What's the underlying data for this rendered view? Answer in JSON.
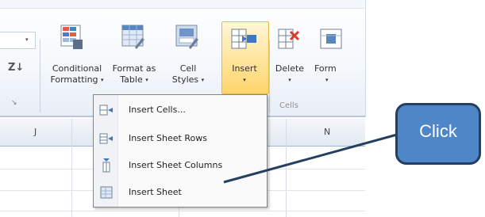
{
  "ribbon": {
    "conditional_formatting": {
      "line1": "Conditional",
      "line2": "Formatting"
    },
    "format_as_table": {
      "line1": "Format as",
      "line2": "Table"
    },
    "cell_styles": {
      "line1": "Cell",
      "line2": "Styles"
    },
    "insert": {
      "line1": "Insert"
    },
    "delete": {
      "line1": "Delete"
    },
    "format": {
      "line1": "Form"
    },
    "cells_group_label": "Cells",
    "dropdown_glyph": "▾",
    "sort_glyph": "Z↓",
    "launcher_glyph": "↘",
    "left_dropdown_glyph": "▾"
  },
  "grid": {
    "col_letters": [
      "J",
      "N"
    ]
  },
  "insert_menu": {
    "items": [
      {
        "label": "Insert Cells...",
        "icon": "insert-cells-icon"
      },
      {
        "label": "Insert Sheet Rows",
        "icon": "insert-rows-icon"
      },
      {
        "label": "Insert Sheet Columns",
        "icon": "insert-columns-icon"
      },
      {
        "label": "Insert Sheet",
        "icon": "insert-sheet-icon"
      }
    ]
  },
  "callout": {
    "text": "Click"
  },
  "colors": {
    "callout_fill": "#4f86c7",
    "callout_border": "#243f60",
    "insert_highlight": "#ffd56b",
    "arrow": "#243f60"
  }
}
